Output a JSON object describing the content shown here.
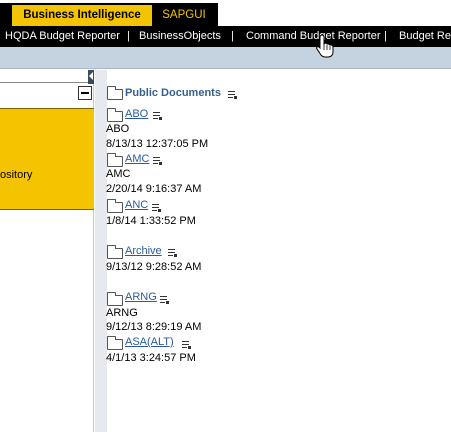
{
  "top_tabs": [
    {
      "label": "Business Intelligence",
      "active": true
    },
    {
      "label": "SAPGUI",
      "active": false
    }
  ],
  "nav": [
    {
      "label": "HQDA Budget Reporter"
    },
    {
      "label": "BusinessObjects"
    },
    {
      "label": "Command Budget Reporter"
    },
    {
      "label": "Budget Rep"
    }
  ],
  "nav_separator": "|",
  "left_pane": {
    "repository_text": "ository"
  },
  "root": {
    "label": "Public Documents"
  },
  "folders": [
    {
      "name": "ABO",
      "description": "ABO",
      "modified": "8/13/13 12:37:05 PM"
    },
    {
      "name": "AMC",
      "description": "AMC",
      "modified": "2/20/14 9:16:37 AM"
    },
    {
      "name": "ANC",
      "description": "",
      "modified": "1/8/14 1:33:52 PM"
    },
    {
      "name": "Archive",
      "description": "",
      "modified": "9/13/12 9:28:52 AM"
    },
    {
      "name": "ARNG",
      "description": "ARNG",
      "modified": "9/12/13 8:29:19 AM"
    },
    {
      "name": "ASA(ALT)",
      "description": "",
      "modified": "4/1/13 3:24:57 PM"
    }
  ],
  "colors": {
    "brand_yellow": "#f5c400",
    "nav_black": "#000000",
    "link_blue": "#2a5a9a",
    "strip": "#c5d2e0"
  },
  "icons": [
    "folder-icon",
    "menu-icon",
    "minimize-icon",
    "hand-cursor-icon"
  ]
}
